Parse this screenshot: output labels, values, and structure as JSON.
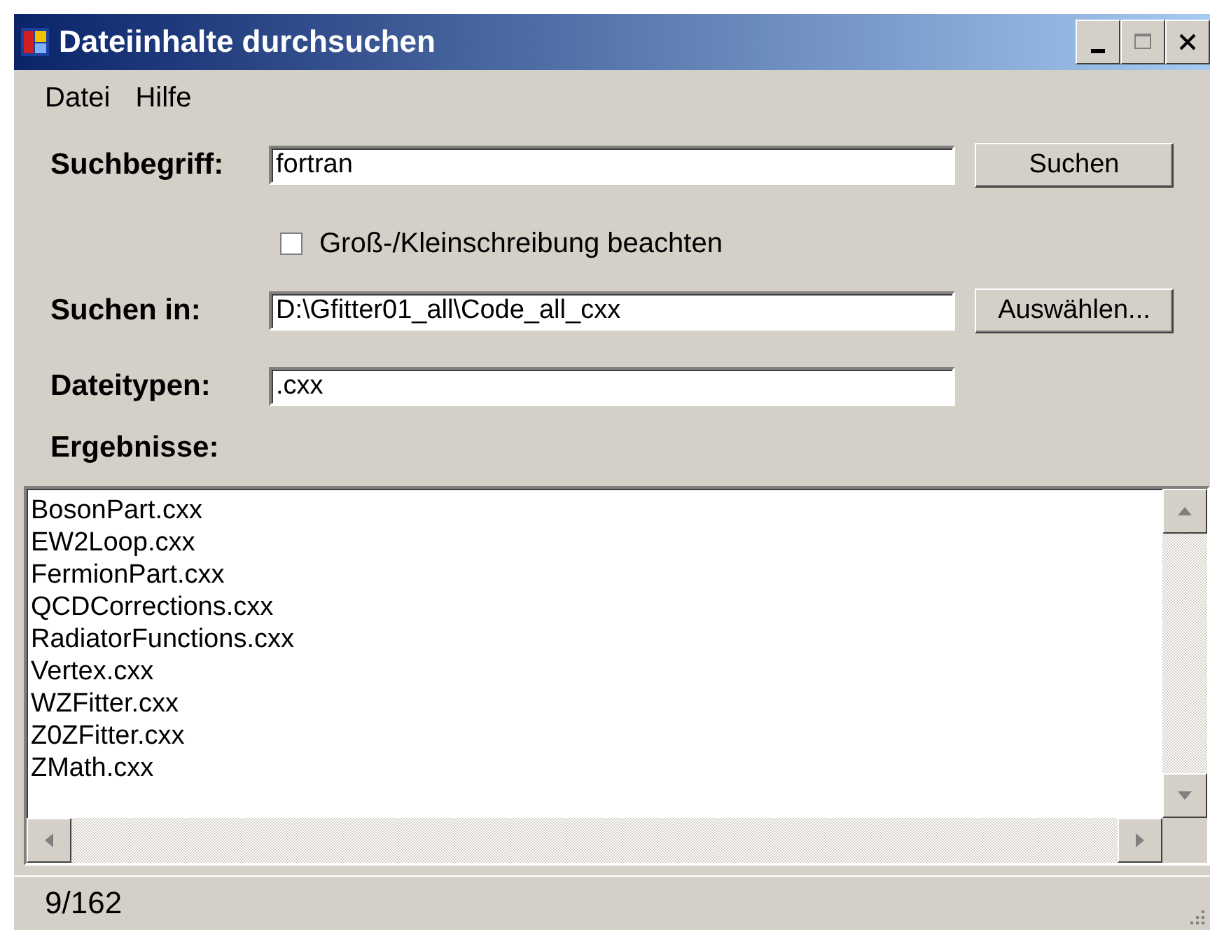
{
  "window": {
    "title": "Dateiinhalte durchsuchen"
  },
  "menu": [
    "Datei",
    "Hilfe"
  ],
  "search_term": {
    "label": "Suchbegriff:",
    "value": "fortran",
    "button": "Suchen"
  },
  "case_sensitive": {
    "label": "Groß-/Kleinschreibung beachten",
    "checked": false
  },
  "search_in": {
    "label": "Suchen in:",
    "value": "D:\\Gfitter01_all\\Code_all_cxx",
    "button": "Auswählen..."
  },
  "file_types": {
    "label": "Dateitypen:",
    "value": ".cxx"
  },
  "results": {
    "label": "Ergebnisse:",
    "items": [
      "BosonPart.cxx",
      "EW2Loop.cxx",
      "FermionPart.cxx",
      "QCDCorrections.cxx",
      "RadiatorFunctions.cxx",
      "Vertex.cxx",
      "WZFitter.cxx",
      "Z0ZFitter.cxx",
      "ZMath.cxx"
    ]
  },
  "status_bar": {
    "count": "9/162"
  }
}
